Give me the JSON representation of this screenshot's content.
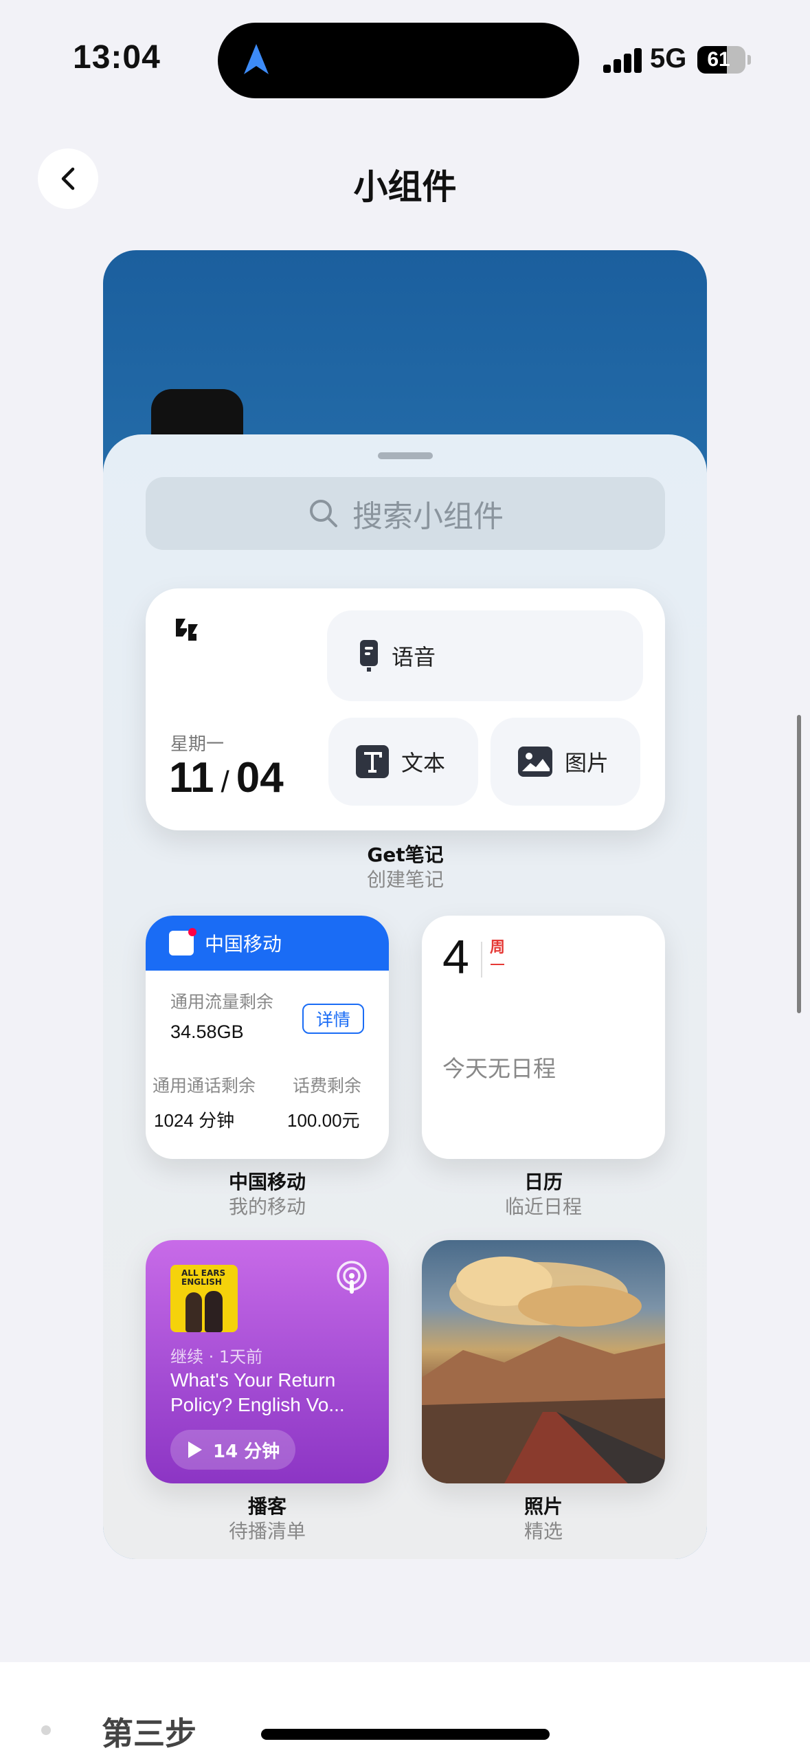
{
  "status_bar": {
    "time": "13:04",
    "network": "5G",
    "battery": "61",
    "battery_level": 0.61,
    "icons": [
      "location-arrow-icon",
      "cellular-signal-icon",
      "battery-icon"
    ]
  },
  "header": {
    "title": "小组件",
    "back_icon": "chevron-left-icon"
  },
  "sheet": {
    "search_placeholder": "搜索小组件",
    "search_icon": "search-icon"
  },
  "widgets": {
    "get": {
      "weekday": "星期一",
      "month": "11",
      "slash": "/",
      "day": "04",
      "voice_label": "语音",
      "text_label": "文本",
      "image_label": "图片",
      "caption_title": "Get笔记",
      "caption_sub": "创建笔记"
    },
    "cmcc": {
      "header": "中国移动",
      "data_label": "通用流量剩余",
      "data_value": "34.58GB",
      "detail_btn": "详情",
      "call_label": "通用通话剩余",
      "balance_label": "话费剩余",
      "call_value": "1024 分钟",
      "balance_value": "100.00元",
      "caption_title": "中国移动",
      "caption_sub": "我的移动",
      "accent": "#1a6cf5"
    },
    "calendar": {
      "day": "4",
      "week_char": "周",
      "week_day": "一",
      "empty_text": "今天无日程",
      "caption_title": "日历",
      "caption_sub": "临近日程"
    },
    "podcast": {
      "cover_text": "ALL EARS ENGLISH",
      "meta": "继续 · 1天前",
      "title": "What's Your Return Policy? English Vo...",
      "play_label": "14 分钟",
      "caption_title": "播客",
      "caption_sub": "待播清单"
    },
    "photos": {
      "caption_title": "照片",
      "caption_sub": "精选"
    }
  },
  "bottom": {
    "step_label": "第三步"
  }
}
